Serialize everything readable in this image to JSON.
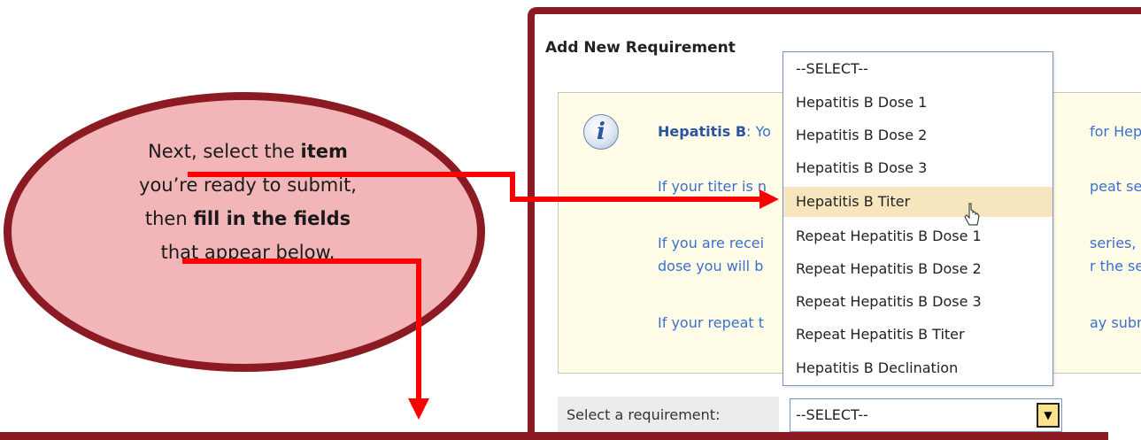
{
  "callout": {
    "line1_pre": "Next, select the ",
    "line1_bold": "item",
    "line2": "you’re ready to submit,",
    "line3_pre": "then ",
    "line3_bold": "fill in the fields",
    "line4": "that appear below."
  },
  "panel": {
    "title": "Add New Requirement",
    "info": {
      "icon": "info-icon",
      "line1_bold": "Hepatitis B",
      "line1_left": ": Yo",
      "line1_right": "for Hepati",
      "line2_left": "If your titer is n",
      "line2_right": "peat series",
      "line3_left": "If you are recei",
      "line3_right": "series, you",
      "line4_left": "dose you will b",
      "line4_right": "r the secon",
      "line5_left": "If your repeat t",
      "line5_right": "ay submit b"
    },
    "select_label": "Select a requirement:",
    "select_value": "--SELECT--",
    "dropdown_arrow": "▼"
  },
  "dropdown": {
    "options": [
      "--SELECT--",
      "Hepatitis B Dose 1",
      "Hepatitis B Dose 2",
      "Hepatitis B Dose 3",
      "Hepatitis B Titer",
      "Repeat Hepatitis B Dose 1",
      "Repeat Hepatitis B Dose 2",
      "Repeat Hepatitis B Dose 3",
      "Repeat Hepatitis B Titer",
      "Hepatitis B Declination"
    ],
    "highlighted": "Hepatitis B Titer"
  },
  "colors": {
    "accent": "#8b1a22",
    "callout_fill": "#f2b6b8",
    "arrow": "#ff0000",
    "info_bg": "#fffde8",
    "highlight": "#f7e6bd"
  }
}
